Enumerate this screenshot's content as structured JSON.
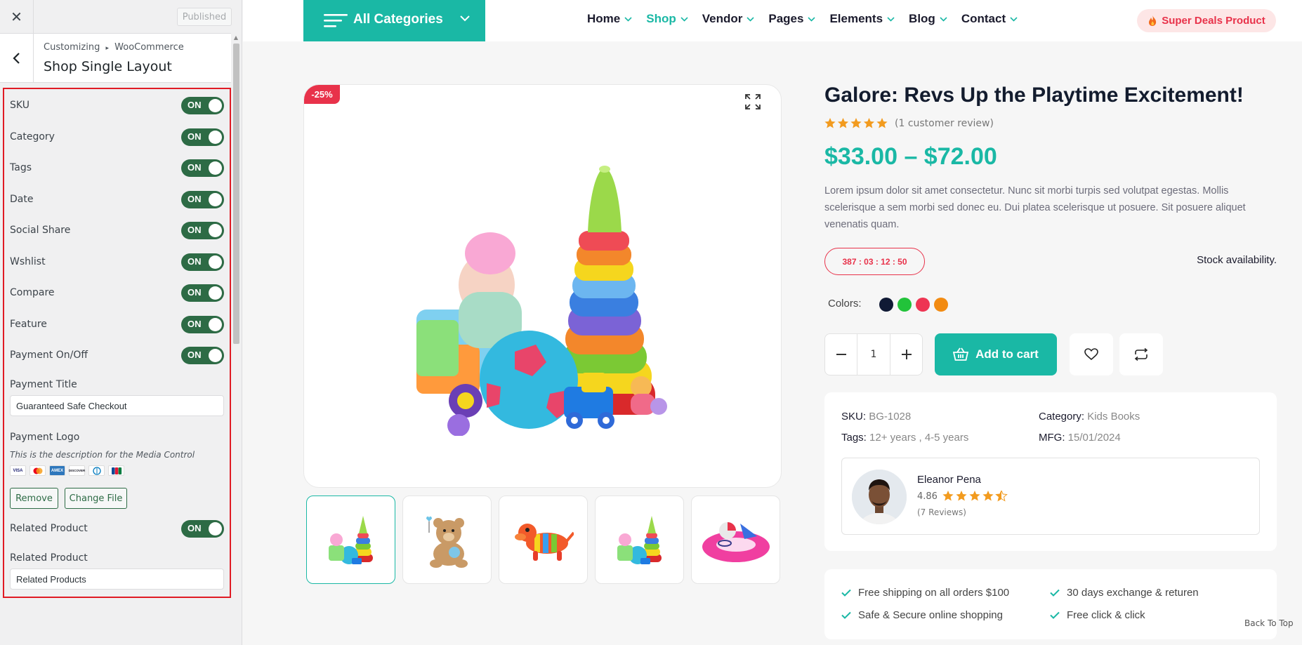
{
  "customizer": {
    "close_icon": "close-icon",
    "published_label": "Published",
    "breadcrumb_root": "Customizing",
    "breadcrumb_sep": "▸",
    "breadcrumb_section": "WooCommerce",
    "panel_title": "Shop Single Layout",
    "toggles": [
      {
        "label": "SKU",
        "state": "ON"
      },
      {
        "label": "Category",
        "state": "ON"
      },
      {
        "label": "Tags",
        "state": "ON"
      },
      {
        "label": "Date",
        "state": "ON"
      },
      {
        "label": "Social Share",
        "state": "ON"
      },
      {
        "label": "Wshlist",
        "state": "ON"
      },
      {
        "label": "Compare",
        "state": "ON"
      },
      {
        "label": "Feature",
        "state": "ON"
      },
      {
        "label": "Payment On/Off",
        "state": "ON"
      }
    ],
    "payment_title_label": "Payment Title",
    "payment_title_value": "Guaranteed Safe Checkout",
    "payment_logo_label": "Payment Logo",
    "payment_logo_desc": "This is the description for the Media Control",
    "payment_logos": [
      "VISA",
      "MC",
      "AMEX",
      "DISCOVER",
      "DINERS",
      "JCB"
    ],
    "remove_label": "Remove",
    "change_file_label": "Change File",
    "related_toggle_label": "Related Product",
    "related_toggle_state": "ON",
    "related_title_label": "Related Product",
    "related_title_value": "Related Products",
    "accent_color": "#2d6b45",
    "highlight_color": "#e01b24"
  },
  "site": {
    "all_categories": "All Categories",
    "nav": [
      {
        "label": "Home",
        "active": false
      },
      {
        "label": "Shop",
        "active": true
      },
      {
        "label": "Vendor",
        "active": false
      },
      {
        "label": "Pages",
        "active": false
      },
      {
        "label": "Elements",
        "active": false
      },
      {
        "label": "Blog",
        "active": false
      },
      {
        "label": "Contact",
        "active": false
      }
    ],
    "super_deals": "Super Deals Product",
    "brand_color": "#1ab8a5",
    "sale_color": "#e8324a"
  },
  "product": {
    "badge": "-25%",
    "title": "Galore: Revs Up the Playtime Excitement!",
    "rating": 5,
    "review_text": "(1 customer review)",
    "price": "$33.00 – $72.00",
    "description": "Lorem ipsum dolor sit amet consectetur. Nunc sit morbi turpis sed volutpat egestas. Mollis scelerisque a sem morbi sed donec eu. Dui platea scelerisque ut posuere. Sit posuere aliquet venenatis quam.",
    "countdown": "387 : 03 : 12 : 50",
    "stock": "Stock availability.",
    "colors_label": "Colors:",
    "colors": [
      "#101a35",
      "#22c33a",
      "#ee3553",
      "#f28b12"
    ],
    "qty": "1",
    "add_to_cart": "Add to cart",
    "sku_label": "SKU:",
    "sku": "BG-1028",
    "category_label": "Category:",
    "category": "Kids Books",
    "tags_label": "Tags:",
    "tags": "12+ years , 4-5 years",
    "mfg_label": "MFG:",
    "mfg": "15/01/2024",
    "vendor_name": "Eleanor Pena",
    "vendor_score": "4.86",
    "vendor_score_stars": 4.5,
    "vendor_reviews": "(7 Reviews)",
    "shipping": [
      "Free shipping on all orders $100",
      "30 days exchange & returen",
      "Safe & Secure online shopping",
      "Free click & click"
    ],
    "thumbnails": [
      "toys-set",
      "teddy-bear",
      "toy-dog",
      "toys-set",
      "swim-ring"
    ]
  },
  "back_to_top": "Back To Top"
}
